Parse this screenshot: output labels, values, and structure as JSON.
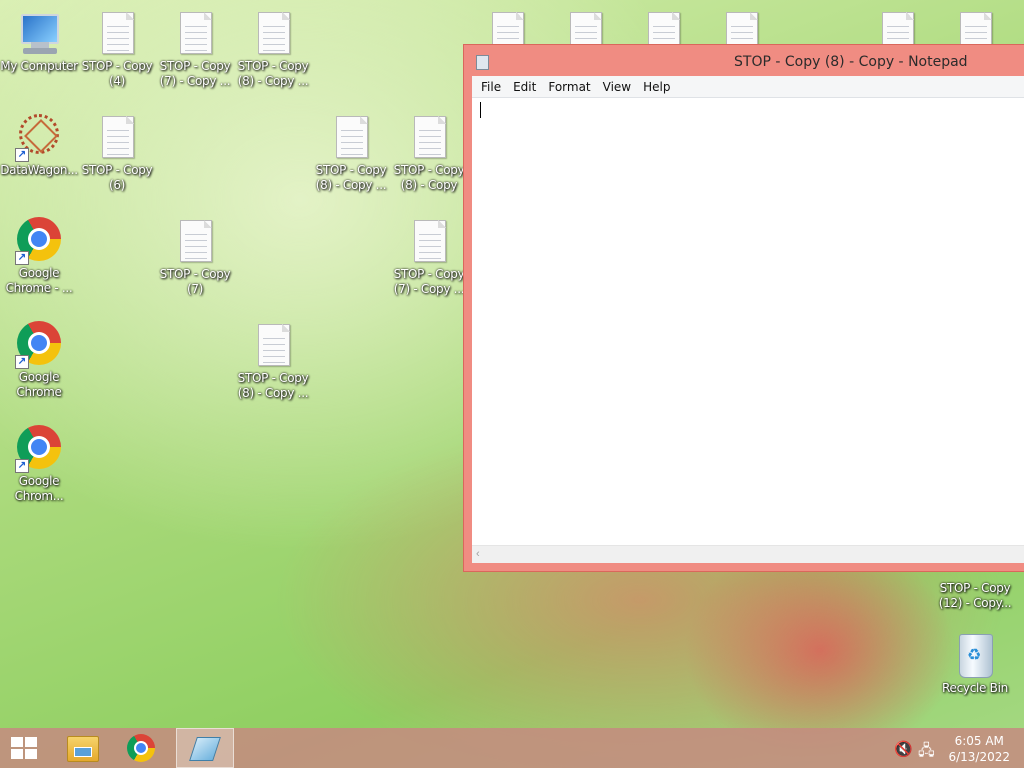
{
  "desktop": {
    "icons": [
      {
        "label": "My Computer"
      },
      {
        "label": "STOP - Copy (4)"
      },
      {
        "label": "STOP - Copy (7) - Copy ..."
      },
      {
        "label": "STOP - Copy (8) - Copy ..."
      },
      {
        "label": "DataWagon..."
      },
      {
        "label": "STOP - Copy (6)"
      },
      {
        "label": "STOP - Copy (8) - Copy ..."
      },
      {
        "label": "STOP - Copy (8) - Copy"
      },
      {
        "label": "Google Chrome - ..."
      },
      {
        "label": "STOP - Copy (7)"
      },
      {
        "label": "STOP - Copy (7) - Copy ..."
      },
      {
        "label": "Google Chrome"
      },
      {
        "label": "STOP - Copy (8) - Copy ..."
      },
      {
        "label": "Google Chrom..."
      },
      {
        "label": "STOP - Copy (12) - Copy..."
      },
      {
        "label": "Recycle Bin"
      }
    ]
  },
  "notepad": {
    "title": "STOP - Copy (8) - Copy - Notepad",
    "menu": [
      "File",
      "Edit",
      "Format",
      "View",
      "Help"
    ],
    "content": ""
  },
  "taskbar": {
    "time": "6:05 AM",
    "date": "6/13/2022"
  }
}
